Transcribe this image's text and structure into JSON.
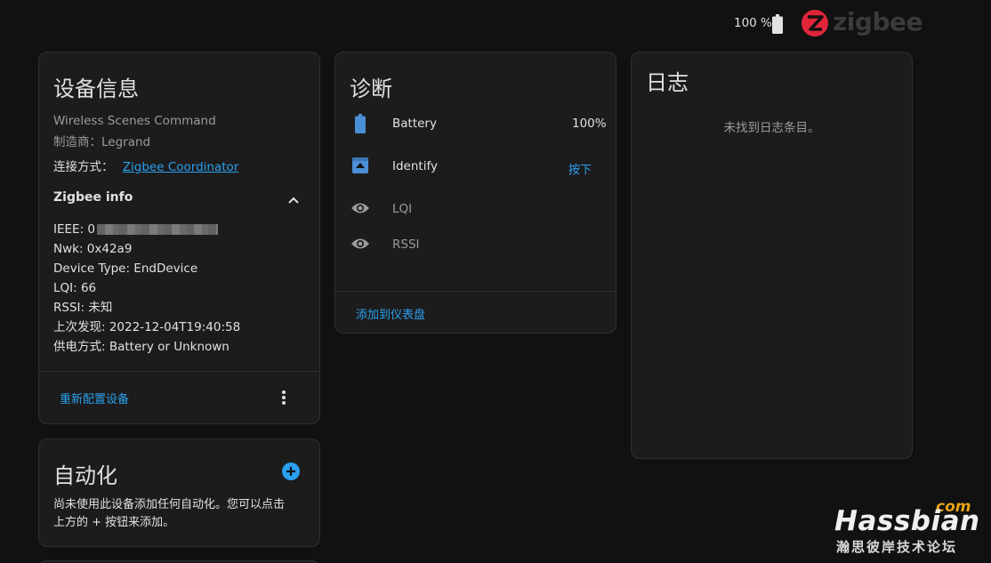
{
  "topbar": {
    "battery_text": "100 %",
    "brand": "zigbee"
  },
  "device_info": {
    "title": "设备信息",
    "model": "Wireless Scenes Command",
    "manufacturer": "制造商：Legrand",
    "connection_label": "连接方式：",
    "connection_link": "Zigbee Coordinator",
    "zigbee_info": {
      "header": "Zigbee info",
      "ieee_label": "IEEE: 0",
      "nwk": "Nwk: 0x42a9",
      "device_type": "Device Type: EndDevice",
      "lqi": "LQI: 66",
      "rssi": "RSSI: 未知",
      "last_seen": "上次发现: 2022-12-04T19:40:58",
      "power_source": "供电方式: Battery or Unknown"
    },
    "reconfigure_button": "重新配置设备"
  },
  "automation": {
    "title": "自动化",
    "description_line1": "尚未使用此设备添加任何自动化。您可以点击",
    "description_line2": "上方的 + 按钮来添加。"
  },
  "diagnostics": {
    "title": "诊断",
    "rows": [
      {
        "label": "Battery",
        "value": "100%",
        "icon": "battery-icon"
      },
      {
        "label": "Identify",
        "value": "按下",
        "icon": "identify-icon"
      },
      {
        "label": "LQI",
        "value": "",
        "icon": "eye-icon"
      },
      {
        "label": "RSSI",
        "value": "",
        "icon": "eye-icon"
      }
    ],
    "add_to_dashboard": "添加到仪表盘"
  },
  "logbook": {
    "title": "日志",
    "empty_text": "未找到日志条目。"
  },
  "watermark": {
    "com": "com",
    "main": "Hassbian",
    "sub": "瀚思彼岸技术论坛"
  },
  "colors": {
    "accent": "#2aa0ee",
    "background": "#111111",
    "card": "#1c1c1c",
    "icon_blue": "#4a8fd6",
    "zigbee_red": "#e0253a"
  }
}
